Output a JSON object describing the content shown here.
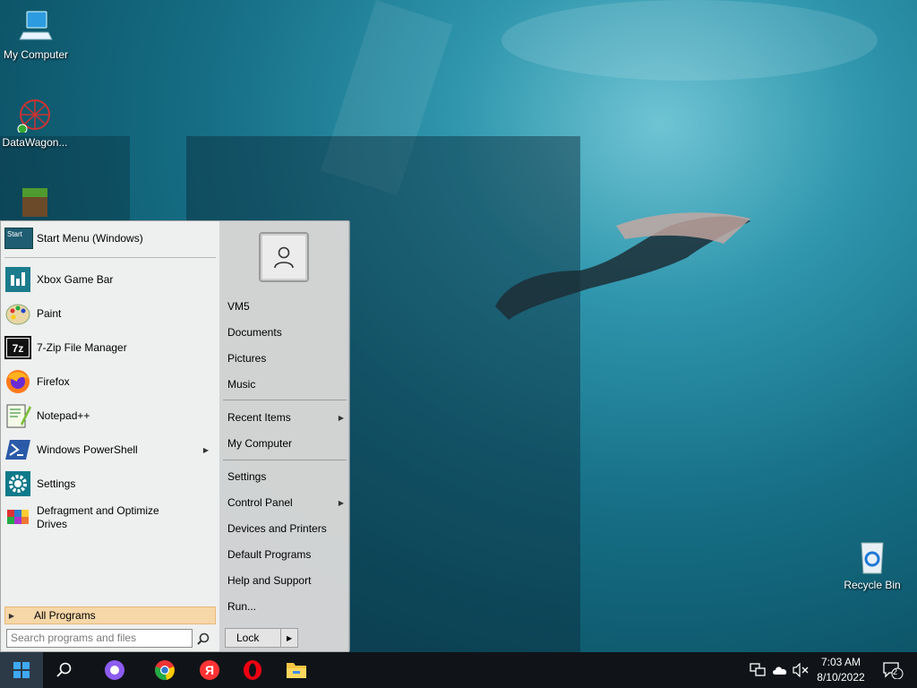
{
  "desktop": {
    "icons": [
      {
        "label": "My Computer",
        "icon": "monitor-icon"
      },
      {
        "label": "DataWagon...",
        "icon": "network-globe-icon"
      },
      {
        "label": "",
        "icon": "minecraft-block-icon"
      },
      {
        "label": "Recycle Bin",
        "icon": "recycle-bin-icon"
      }
    ]
  },
  "start_menu": {
    "header_title": "Start Menu (Windows)",
    "header_logo_text": "Start",
    "apps": [
      {
        "label": "Xbox Game Bar",
        "icon": "xbox-game-bar-icon"
      },
      {
        "label": "Paint",
        "icon": "paint-icon"
      },
      {
        "label": "7-Zip File Manager",
        "icon": "7zip-icon"
      },
      {
        "label": "Firefox",
        "icon": "firefox-icon"
      },
      {
        "label": "Notepad++",
        "icon": "notepadpp-icon"
      },
      {
        "label": "Windows PowerShell",
        "icon": "powershell-icon",
        "has_submenu": true
      },
      {
        "label": "Settings",
        "icon": "settings-gear-icon"
      },
      {
        "label": "Defragment and Optimize Drives",
        "icon": "defrag-icon"
      }
    ],
    "all_programs": "All Programs",
    "search_placeholder": "Search programs and files",
    "right_items_group1": [
      {
        "label": "VM5"
      },
      {
        "label": "Documents"
      },
      {
        "label": "Pictures"
      },
      {
        "label": "Music"
      }
    ],
    "right_items_group2": [
      {
        "label": "Recent Items",
        "has_submenu": true
      },
      {
        "label": "My Computer"
      }
    ],
    "right_items_group3": [
      {
        "label": "Settings"
      },
      {
        "label": "Control Panel",
        "has_submenu": true
      },
      {
        "label": "Devices and Printers"
      },
      {
        "label": "Default Programs"
      },
      {
        "label": "Help and Support"
      },
      {
        "label": "Run..."
      }
    ],
    "lock_label": "Lock"
  },
  "taskbar": {
    "pinned": [
      "search-icon",
      "alice-icon",
      "chrome-icon",
      "yandex-icon",
      "opera-icon",
      "file-explorer-icon"
    ],
    "clock_time": "7:03 AM",
    "clock_date": "8/10/2022",
    "notification_count": "2"
  },
  "colors": {
    "taskbar": "#101418",
    "all_programs_highlight": "#f6d7a8",
    "start_button_bg": "#2c3a48"
  }
}
